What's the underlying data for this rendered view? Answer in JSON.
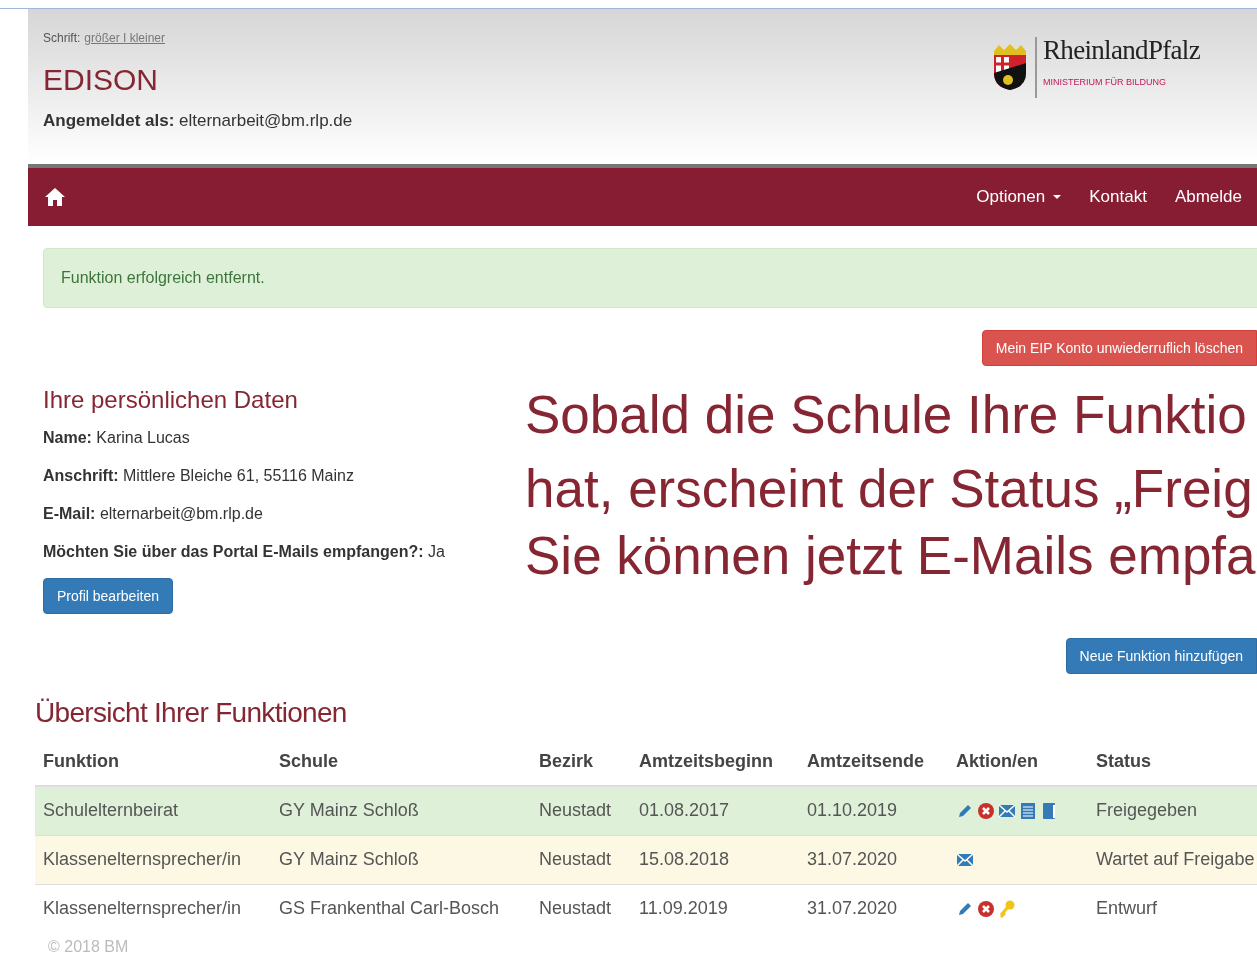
{
  "header": {
    "font_label": "Schrift:",
    "font_links": [
      "größer",
      "I",
      "kleiner"
    ],
    "title": "EDISON",
    "logged_in_label": "Angemeldet als:",
    "logged_in_value": "elternarbeit@bm.rlp.de",
    "logo_name": "RheinlandPfalz",
    "logo_subtitle": "MINISTERIUM FÜR BILDUNG"
  },
  "nav": {
    "items": [
      {
        "label": "Optionen",
        "dropdown": true
      },
      {
        "label": "Kontakt",
        "dropdown": false
      },
      {
        "label": "Abmelde",
        "dropdown": false
      }
    ]
  },
  "alert": "Funktion erfolgreich entfernt.",
  "delete_button": "Mein EIP Konto unwiederruflich löschen",
  "personal": {
    "title": "Ihre persönlichen Daten",
    "fields": [
      {
        "label": "Name:",
        "value": "Karina Lucas"
      },
      {
        "label": "Anschrift:",
        "value": "Mittlere Bleiche 61, 55116 Mainz"
      },
      {
        "label": "E-Mail:",
        "value": "elternarbeit@bm.rlp.de"
      },
      {
        "label": "Möchten Sie über das Portal E-Mails empfangen?:",
        "value": "Ja"
      }
    ],
    "edit_button": "Profil bearbeiten"
  },
  "annotation": [
    "Sobald die Schule Ihre Funktio",
    "hat, erscheint der Status „Freig",
    "Sie können jetzt E-Mails empfa"
  ],
  "add_button": "Neue Funktion hinzufügen",
  "functions": {
    "title": "Übersicht Ihrer Funktionen",
    "columns": [
      "Funktion",
      "Schule",
      "Bezirk",
      "Amtzeitsbeginn",
      "Amtzeitsende",
      "Aktion/en",
      "Status"
    ],
    "rows": [
      {
        "color": "#dff0d8",
        "cells": [
          "Schulelternbeirat",
          "GY Mainz Schloß",
          "Neustadt",
          "01.08.2017",
          "01.10.2019"
        ],
        "actions": [
          {
            "kind": "edit"
          },
          {
            "kind": "delete"
          },
          {
            "kind": "mail"
          },
          {
            "kind": "list"
          },
          {
            "kind": "book"
          }
        ],
        "status": "Freigegeben"
      },
      {
        "color": "#fcf8e3",
        "cells": [
          "Klassenelternsprecher/in",
          "GY Mainz Schloß",
          "Neustadt",
          "15.08.2018",
          "31.07.2020"
        ],
        "actions": [
          {
            "kind": "mail"
          }
        ],
        "status": "Wartet auf Freigabe"
      },
      {
        "color": "#ffffff",
        "cells": [
          "Klassenelternsprecher/in",
          "GS Frankenthal Carl-Bosch",
          "Neustadt",
          "11.09.2019",
          "31.07.2020"
        ],
        "actions": [
          {
            "kind": "edit"
          },
          {
            "kind": "delete"
          },
          {
            "kind": "key"
          }
        ],
        "status": "Entwurf"
      }
    ]
  },
  "footer": "© 2018 BM"
}
